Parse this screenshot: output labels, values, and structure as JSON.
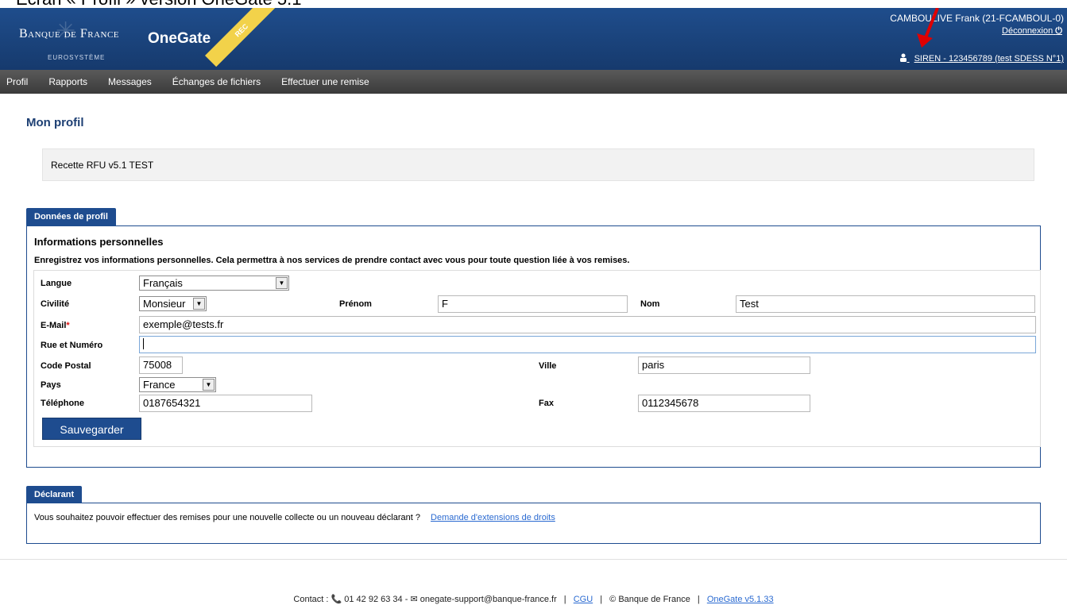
{
  "caption": "Ecran « Profil » version OneGate 5.1",
  "header": {
    "brand": "Banque de France",
    "brand_sub": "EUROSYSTÈME",
    "app_name": "OneGate",
    "ribbon": "REC",
    "user": "CAMBOULIVE Frank (21-FCAMBOUL-0)",
    "logout": "Déconnexion",
    "siren": "SIREN - 123456789 (test SDESS N°1)"
  },
  "nav": {
    "items": [
      "Profil",
      "Rapports",
      "Messages",
      "Échanges de fichiers",
      "Effectuer une remise"
    ]
  },
  "page": {
    "title": "Mon profil",
    "info": "Recette RFU v5.1 TEST"
  },
  "profile": {
    "tab": "Données de profil",
    "section_title": "Informations personnelles",
    "section_desc": "Enregistrez vos informations personnelles. Cela permettra à nos services de prendre contact avec vous pour toute question liée à vos remises.",
    "labels": {
      "langue": "Langue",
      "civilite": "Civilité",
      "prenom": "Prénom",
      "nom": "Nom",
      "email": "E-Mail",
      "required": "*",
      "rue": "Rue et Numéro",
      "cp": "Code Postal",
      "ville": "Ville",
      "pays": "Pays",
      "telephone": "Téléphone",
      "fax": "Fax"
    },
    "values": {
      "langue": "Français",
      "civilite": "Monsieur",
      "prenom": "F",
      "nom": "Test",
      "email": "exemple@tests.fr",
      "rue": "",
      "cp": "75008",
      "ville": "paris",
      "pays": "France",
      "telephone": "0187654321",
      "fax": "0112345678"
    },
    "save_label": "Sauvegarder"
  },
  "declarant": {
    "tab": "Déclarant",
    "text": "Vous souhaitez pouvoir effectuer des remises pour une nouvelle collecte ou un nouveau déclarant ?",
    "link": "Demande d'extensions de droits"
  },
  "footer": {
    "contact_label": "Contact :",
    "phone": "01 42 92 63 34 -",
    "email": "onegate-support@banque-france.fr",
    "cgu": "CGU",
    "copyright": "© Banque de France",
    "version": "OneGate v5.1.33"
  },
  "colors": {
    "header_blue": "#1f4d8c",
    "nav_gray": "#4a4a4a",
    "ribbon_yellow": "#f2d24a",
    "arrow_red": "#e00000",
    "link_blue": "#2a6ad1"
  },
  "icons": [
    "user-icon",
    "power-icon",
    "phone-icon",
    "mail-icon",
    "dropdown-arrow-icon"
  ]
}
